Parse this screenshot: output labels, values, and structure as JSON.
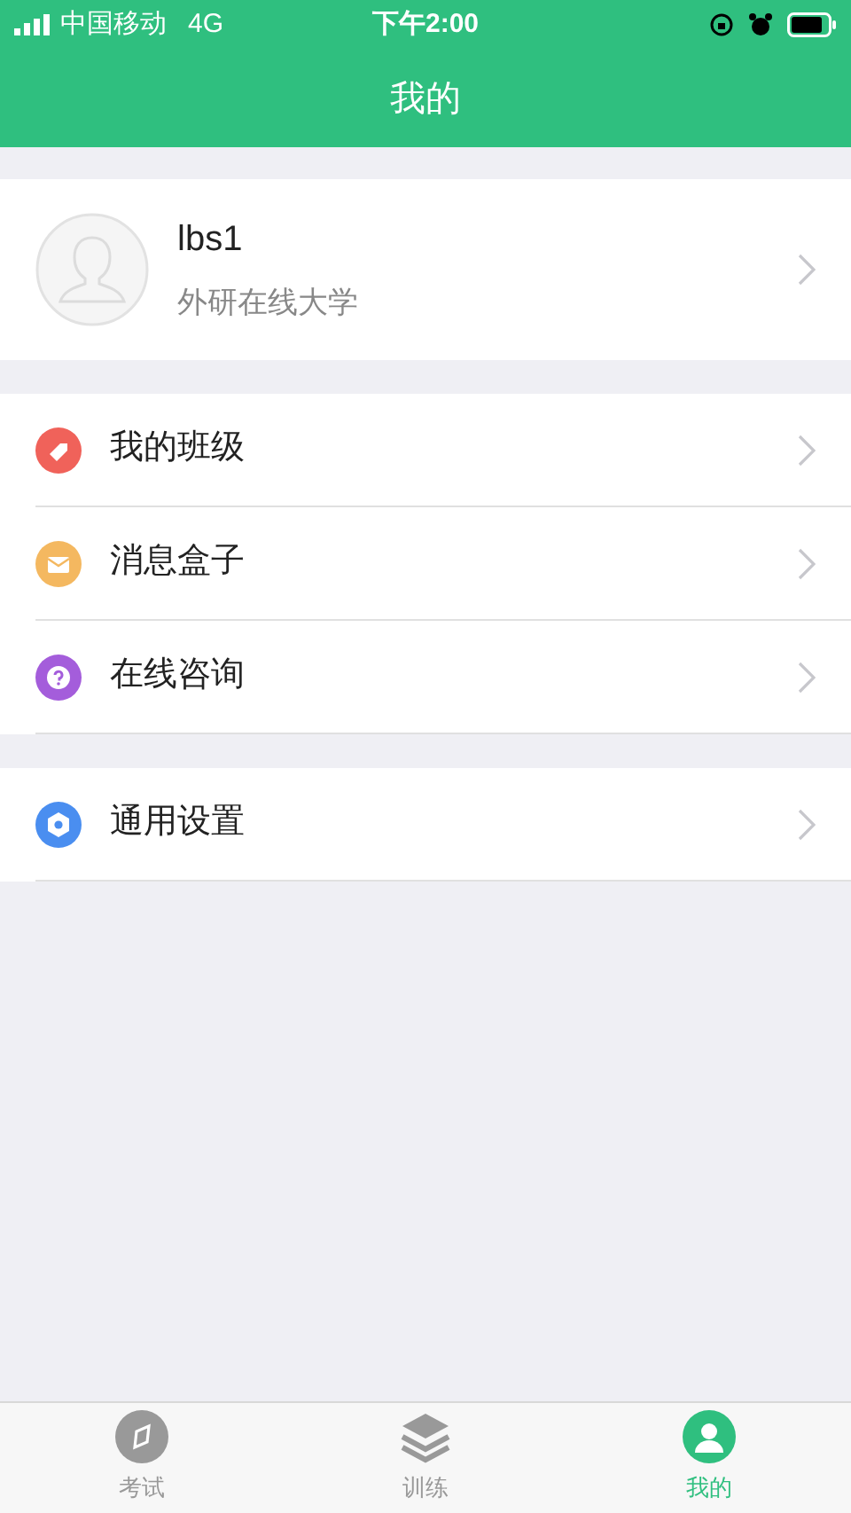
{
  "status_bar": {
    "carrier": "中国移动",
    "network": "4G",
    "time": "下午2:00"
  },
  "header": {
    "title": "我的"
  },
  "profile": {
    "name": "lbs1",
    "school": "外研在线大学"
  },
  "menu_groups": [
    {
      "items": [
        {
          "kind": "tag",
          "label": "我的班级",
          "color": "#f0625a"
        },
        {
          "kind": "mail",
          "label": "消息盒子",
          "color": "#f4b860"
        },
        {
          "kind": "question",
          "label": "在线咨询",
          "color": "#a45ddb"
        }
      ]
    },
    {
      "items": [
        {
          "kind": "settings",
          "label": "通用设置",
          "color": "#4a8ef0"
        }
      ]
    }
  ],
  "tab_bar": [
    {
      "kind": "compass",
      "label": "考试",
      "selected": false
    },
    {
      "kind": "layers",
      "label": "训练",
      "selected": false
    },
    {
      "kind": "person",
      "label": "我的",
      "selected": true
    }
  ]
}
